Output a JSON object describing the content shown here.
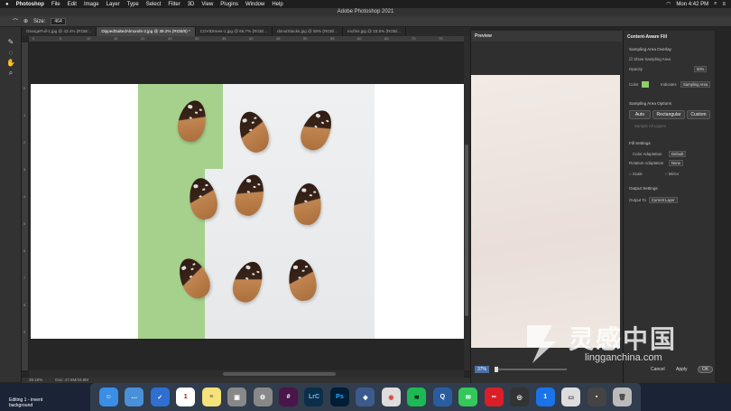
{
  "menubar": {
    "app_name": "Photoshop",
    "items": [
      "File",
      "Edit",
      "Image",
      "Layer",
      "Type",
      "Select",
      "Filter",
      "3D",
      "View",
      "Plugins",
      "Window",
      "Help"
    ],
    "clock": "Mon 4:42 PM"
  },
  "window_title": "Adobe Photoshop 2021",
  "options": {
    "size_label": "Size:",
    "size_value": "464"
  },
  "tabs": [
    {
      "label": "OrangeFull-1.jpg @ 43.4% (RGB/..."
    },
    {
      "label": "DippedSaltedAlmonds-2.jpg @ 39.2% (RGB/8) *"
    },
    {
      "label": "COVIDtrees-1.jpg @ 66.7% (RGB/..."
    },
    {
      "label": "donutStacks.jpg @ 50% (RGB/..."
    },
    {
      "label": "mufins.jpg @ 33.5% (RGB/..."
    }
  ],
  "ruler_top": [
    "0",
    "5",
    "10",
    "15",
    "20",
    "25",
    "30",
    "35",
    "40",
    "45",
    "50",
    "55",
    "60",
    "65",
    "70",
    "75"
  ],
  "ruler_left": [
    "0",
    "1",
    "2",
    "3",
    "4",
    "5",
    "6",
    "7",
    "8",
    "9"
  ],
  "statusbar": {
    "zoom": "39.18%",
    "doc": "Doc: 47.5M/43.8M"
  },
  "preview": {
    "title": "Preview",
    "zoom": "37%"
  },
  "panel": {
    "title": "Content-Aware Fill",
    "sampling_overlay_header": "Sampling Area Overlay",
    "show_sampling": "Show Sampling Area",
    "opacity_label": "Opacity",
    "opacity_value": "50%",
    "color_label": "Color",
    "indicates_label": "Indicates",
    "indicates_value": "Sampling Area",
    "sampling_options_header": "Sampling Area Options",
    "btn_auto": "Auto",
    "btn_rect": "Rectangular",
    "btn_custom": "Custom",
    "sample_all_layers": "Sample All Layers",
    "fill_settings_header": "Fill Settings",
    "color_adapt_label": "Color Adaptation",
    "color_adapt_value": "Default",
    "rot_adapt_label": "Rotation Adaptation",
    "rot_adapt_value": "None",
    "scale_label": "Scale",
    "mirror_label": "Mirror",
    "output_header": "Output Settings",
    "output_to_label": "Output To",
    "output_to_value": "Current Layer",
    "cancel": "Cancel",
    "apply": "Apply",
    "ok": "OK",
    "overlay_color": "#8fce6a"
  },
  "dock_note": "Editing 1 - invent background",
  "dock_icons": [
    {
      "name": "finder",
      "color": "#3a8ee6",
      "glyph": "☺"
    },
    {
      "name": "messages-alt",
      "color": "#4a90d9",
      "glyph": "…"
    },
    {
      "name": "tasks",
      "color": "#2f6fd1",
      "glyph": "✓"
    },
    {
      "name": "calendar",
      "color": "#ffffff",
      "glyph": "1"
    },
    {
      "name": "notes",
      "color": "#f5e27a",
      "glyph": "≡"
    },
    {
      "name": "preview-app",
      "color": "#888888",
      "glyph": "▣"
    },
    {
      "name": "system-preferences",
      "color": "#888888",
      "glyph": "⚙"
    },
    {
      "name": "slack",
      "color": "#4a154b",
      "glyph": "#"
    },
    {
      "name": "lightroom",
      "color": "#0b2f4a",
      "glyph": "LrC"
    },
    {
      "name": "photoshop",
      "color": "#001e36",
      "glyph": "Ps"
    },
    {
      "name": "lightroom-classic",
      "color": "#3b5b8c",
      "glyph": "◆"
    },
    {
      "name": "chrome",
      "color": "#dddddd",
      "glyph": "◉"
    },
    {
      "name": "spotify",
      "color": "#1db954",
      "glyph": "≋"
    },
    {
      "name": "quicktime",
      "color": "#2a5d9f",
      "glyph": "Q"
    },
    {
      "name": "messages",
      "color": "#34c759",
      "glyph": "✉"
    },
    {
      "name": "creative-cloud",
      "color": "#da1f26",
      "glyph": "∞"
    },
    {
      "name": "camera-app",
      "color": "#333333",
      "glyph": "◎"
    },
    {
      "name": "1password",
      "color": "#1a73e8",
      "glyph": "1"
    },
    {
      "name": "screenshot",
      "color": "#dddddd",
      "glyph": "▭"
    },
    {
      "name": "photo-thumb",
      "color": "#444444",
      "glyph": "▪"
    },
    {
      "name": "trash",
      "color": "#bbbbbb",
      "glyph": "🗑"
    }
  ],
  "watermark": {
    "main": "灵感中国",
    "sub": "lingganchina.com"
  }
}
